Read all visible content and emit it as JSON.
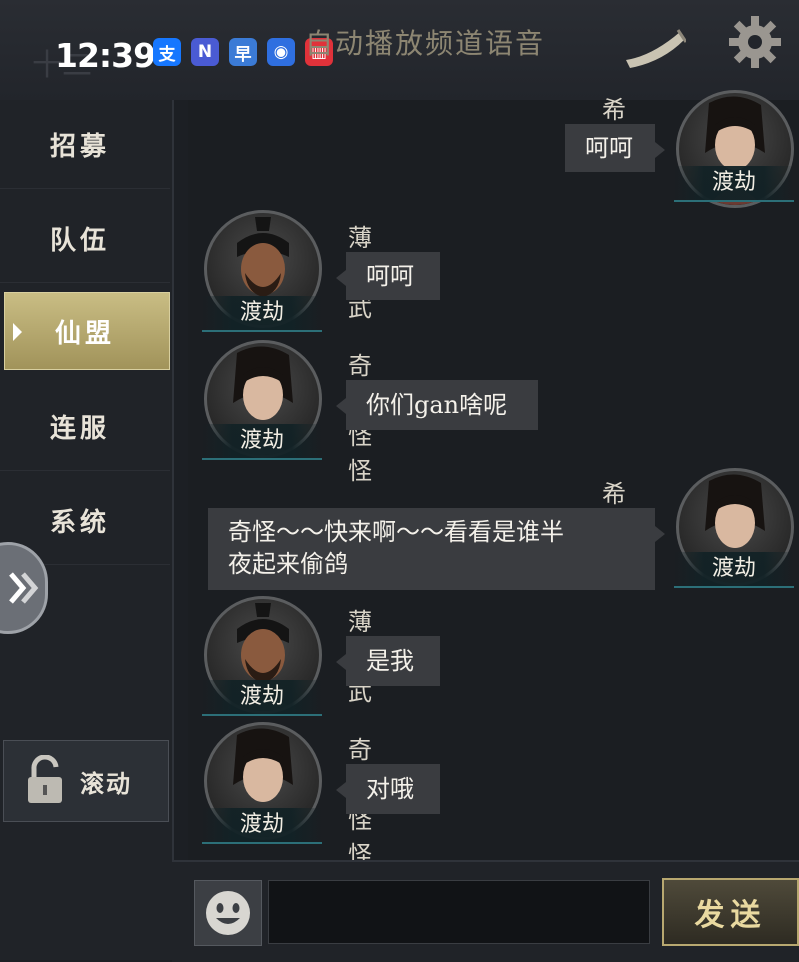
{
  "status_bar": {
    "time": "12:39",
    "ghost_time": "十二",
    "app_icons": [
      {
        "name": "alipay-icon",
        "glyph": "支",
        "color": "#1677ff"
      },
      {
        "name": "notes-n-icon",
        "glyph": "N",
        "color": "#4a5bd4"
      },
      {
        "name": "app-square-icon",
        "glyph": "早",
        "color": "#3b7bd6"
      },
      {
        "name": "circle-app-icon",
        "glyph": "◉",
        "color": "#2f6fe0"
      },
      {
        "name": "book-app-icon",
        "glyph": "▥",
        "color": "#e0323a"
      }
    ]
  },
  "header": {
    "voice_channel_label": "自动播放频道语音"
  },
  "sidebar": {
    "items": [
      {
        "label": "招募",
        "active": false
      },
      {
        "label": "队伍",
        "active": false
      },
      {
        "label": "仙盟",
        "active": true
      },
      {
        "label": "连服",
        "active": false
      },
      {
        "label": "系统",
        "active": false
      }
    ],
    "scroll_label": "滚动"
  },
  "messages": [
    {
      "side": "right",
      "sender": "希宁",
      "rank": "渡劫",
      "text": "呵呵",
      "avatar": "female"
    },
    {
      "side": "left",
      "sender": "薄元武",
      "rank": "渡劫",
      "text": "呵呵",
      "avatar": "male"
    },
    {
      "side": "left",
      "sender": "奇奇怪怪",
      "rank": "渡劫",
      "text": "你们gan啥呢",
      "avatar": "female"
    },
    {
      "side": "right",
      "sender": "希宁",
      "rank": "渡劫",
      "text_line1": "奇怪～～快来啊～～看看是谁半",
      "text_line2": "夜起来偷鸽",
      "avatar": "female"
    },
    {
      "side": "left",
      "sender": "薄元武",
      "rank": "渡劫",
      "text": "是我",
      "avatar": "male"
    },
    {
      "side": "left",
      "sender": "奇奇怪怪",
      "rank": "渡劫",
      "text": "对哦",
      "avatar": "female"
    }
  ],
  "input": {
    "value": "",
    "send_label": "发送"
  },
  "colors": {
    "accent_gold": "#b8a870",
    "active_tab": "#c9bd84",
    "bubble": "#3a3c40",
    "rank_underline": "#2c6f78"
  }
}
